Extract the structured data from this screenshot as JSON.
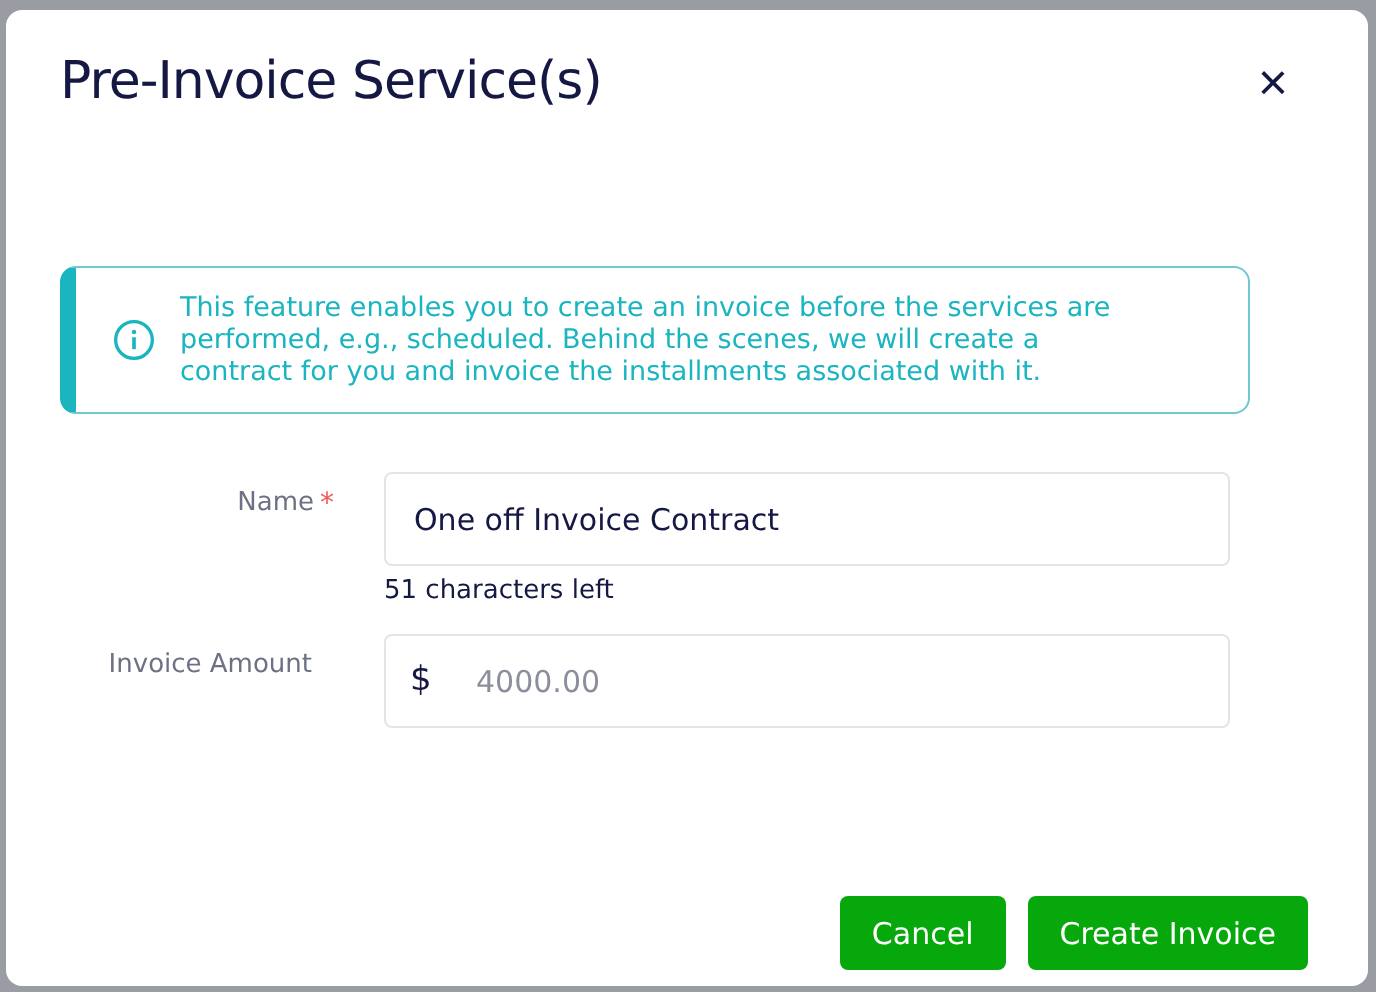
{
  "dialog": {
    "title": "Pre-Invoice Service(s)",
    "close": "×"
  },
  "notice": {
    "text": "This feature enables you to create an invoice before the services are performed, e.g., scheduled. Behind the scenes, we will create a contract for you and invoice the installments associated with it."
  },
  "fields": [
    {
      "kind": "text",
      "label": "Name",
      "required": true,
      "required_mark": "*",
      "value": "One off Invoice Contract",
      "hint": "51 characters left"
    },
    {
      "kind": "currency",
      "label": "Invoice Amount",
      "required": false,
      "prefix": "$",
      "placeholder": "4000.00"
    }
  ],
  "buttons": [
    {
      "label": "Cancel"
    },
    {
      "label": "Create Invoice"
    }
  ]
}
